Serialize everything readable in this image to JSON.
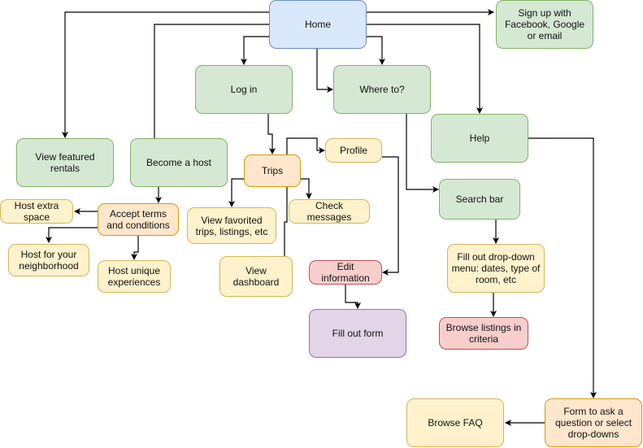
{
  "diagram": {
    "type": "flowchart",
    "nodes": {
      "home": {
        "label": "Home",
        "color": "#dae8fc"
      },
      "signup": {
        "label": "Sign up with Facebook, Google or email",
        "color": "#d5e8d4"
      },
      "login": {
        "label": "Log in",
        "color": "#d5e8d4"
      },
      "where_to": {
        "label": "Where to?",
        "color": "#d5e8d4"
      },
      "help": {
        "label": "Help",
        "color": "#d5e8d4"
      },
      "view_featured": {
        "label": "View featured rentals",
        "color": "#d5e8d4"
      },
      "become_host": {
        "label": "Become a host",
        "color": "#d5e8d4"
      },
      "trips": {
        "label": "Trips",
        "color": "#ffe6cc"
      },
      "profile": {
        "label": "Profile",
        "color": "#fff2cc"
      },
      "search_bar": {
        "label": "Search bar",
        "color": "#d5e8d4"
      },
      "host_extra": {
        "label": "Host extra space",
        "color": "#fff2cc"
      },
      "accept_terms": {
        "label": "Accept terms and conditions",
        "color": "#ffe6cc"
      },
      "view_favorited": {
        "label": "View favorited trips, listings, etc",
        "color": "#fff2cc"
      },
      "check_messages": {
        "label": "Check messages",
        "color": "#fff2cc"
      },
      "host_neighborhood": {
        "label": "Host for your neighborhood",
        "color": "#fff2cc"
      },
      "host_unique": {
        "label": "Host unique experiences",
        "color": "#fff2cc"
      },
      "view_dashboard": {
        "label": "View dashboard",
        "color": "#fff2cc"
      },
      "edit_info": {
        "label": "Edit information",
        "color": "#f8cecc"
      },
      "fill_dropdown": {
        "label": "Fill out drop-down menu: dates, type of room, etc",
        "color": "#fff2cc"
      },
      "fill_form": {
        "label": "Fill out form",
        "color": "#e1d5e7"
      },
      "browse_listings": {
        "label": "Browse listings in criteria",
        "color": "#f8cecc"
      },
      "browse_faq": {
        "label": "Browse FAQ",
        "color": "#fff2cc"
      },
      "help_form": {
        "label": "Form to ask a question or select drop-downs",
        "color": "#ffe6cc"
      }
    },
    "edges": [
      {
        "from": "home",
        "to": "signup"
      },
      {
        "from": "home",
        "to": "login"
      },
      {
        "from": "home",
        "to": "where_to"
      },
      {
        "from": "home",
        "to": "help"
      },
      {
        "from": "home",
        "to": "view_featured"
      },
      {
        "from": "home",
        "to": "become_host"
      },
      {
        "from": "login",
        "to": "trips"
      },
      {
        "from": "trips",
        "to": "profile"
      },
      {
        "from": "trips",
        "to": "view_favorited"
      },
      {
        "from": "trips",
        "to": "check_messages"
      },
      {
        "from": "trips",
        "to": "view_dashboard"
      },
      {
        "from": "profile",
        "to": "edit_info"
      },
      {
        "from": "edit_info",
        "to": "fill_form"
      },
      {
        "from": "become_host",
        "to": "accept_terms"
      },
      {
        "from": "accept_terms",
        "to": "host_extra"
      },
      {
        "from": "accept_terms",
        "to": "host_neighborhood"
      },
      {
        "from": "accept_terms",
        "to": "host_unique"
      },
      {
        "from": "where_to",
        "to": "search_bar"
      },
      {
        "from": "search_bar",
        "to": "fill_dropdown"
      },
      {
        "from": "fill_dropdown",
        "to": "browse_listings"
      },
      {
        "from": "help",
        "to": "help_form"
      },
      {
        "from": "help_form",
        "to": "browse_faq"
      }
    ]
  }
}
